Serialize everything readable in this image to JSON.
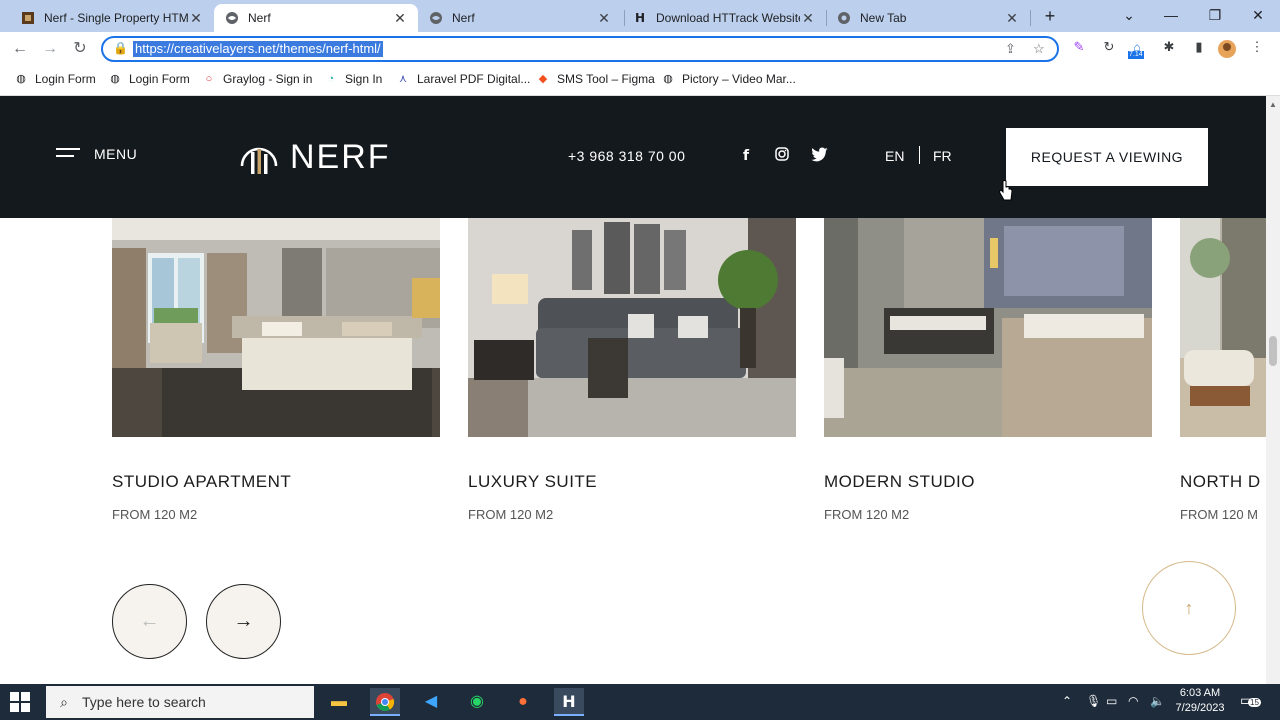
{
  "browser": {
    "tabs": [
      {
        "title": "Nerf - Single Property HTML",
        "icon": "nerf-page-icon",
        "active": false
      },
      {
        "title": "Nerf",
        "icon": "globe-icon",
        "active": true
      },
      {
        "title": "Nerf",
        "icon": "globe-icon",
        "active": false
      },
      {
        "title": "Download HTTrack Website",
        "icon": "httrack-icon",
        "active": false
      },
      {
        "title": "New Tab",
        "icon": "chrome-icon",
        "active": false
      }
    ],
    "url": "https://creativelayers.net/themes/nerf-html/",
    "bookmarks": [
      {
        "label": "Login Form",
        "icon": "globe-icon"
      },
      {
        "label": "Login Form",
        "icon": "globe-icon"
      },
      {
        "label": "Graylog - Sign in",
        "icon": "graylog-icon"
      },
      {
        "label": "Sign In",
        "icon": "signin-icon"
      },
      {
        "label": "Laravel PDF Digital...",
        "icon": "laravel-icon"
      },
      {
        "label": "SMS Tool – Figma",
        "icon": "figma-icon"
      },
      {
        "label": "Pictory – Video Mar...",
        "icon": "globe-icon"
      }
    ],
    "extension_badge": "7.14"
  },
  "site": {
    "menu_label": "MENU",
    "logo_text": "NERF",
    "phone": "+3 968 318 70 00",
    "social": [
      "facebook-icon",
      "instagram-icon",
      "twitter-icon"
    ],
    "languages": [
      "EN",
      "FR"
    ],
    "cta_label": "REQUEST A VIEWING",
    "cards": [
      {
        "title": "STUDIO APARTMENT",
        "subtitle": "FROM 120 M2"
      },
      {
        "title": "LUXURY SUITE",
        "subtitle": "FROM 120 M2"
      },
      {
        "title": "MODERN STUDIO",
        "subtitle": "FROM 120 M2"
      },
      {
        "title": "NORTH D",
        "subtitle": "FROM 120 M"
      }
    ],
    "prev_arrow": "←",
    "next_arrow": "→",
    "to_top_arrow": "↑"
  },
  "taskbar": {
    "search_placeholder": "Type here to search",
    "time": "6:03 AM",
    "date": "7/29/2023",
    "notification_count": "15"
  }
}
